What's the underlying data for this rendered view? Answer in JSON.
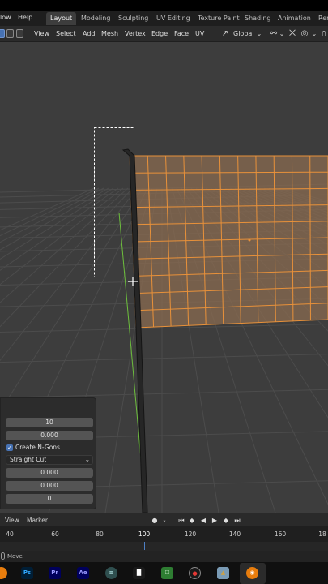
{
  "topbar": {
    "menus": [
      {
        "label": "low"
      },
      {
        "label": "Help"
      }
    ],
    "workspaces": [
      {
        "label": "Layout",
        "active": true
      },
      {
        "label": "Modeling"
      },
      {
        "label": "Sculpting"
      },
      {
        "label": "UV Editing"
      },
      {
        "label": "Texture Paint"
      },
      {
        "label": "Shading"
      },
      {
        "label": "Animation"
      },
      {
        "label": "Ren"
      }
    ]
  },
  "header": {
    "menus": [
      {
        "label": "View"
      },
      {
        "label": "Select"
      },
      {
        "label": "Add"
      },
      {
        "label": "Mesh"
      },
      {
        "label": "Vertex"
      },
      {
        "label": "Edge"
      },
      {
        "label": "Face"
      },
      {
        "label": "UV"
      }
    ],
    "transform_orientation": "Global",
    "select_modes": [
      "vertex",
      "edge",
      "face"
    ],
    "icons": [
      "transform-orientation-icon",
      "snap-icon",
      "proportional-editing-icon"
    ]
  },
  "viewport": {
    "grid_color": "#4a4a4a",
    "background": "#3d3d3d",
    "selection_color": "#e8913a",
    "y_axis_color": "#6dbf3d"
  },
  "operator_panel": {
    "number_of_cuts": "10",
    "smoothness": "0.000",
    "create_ngons_label": "Create N-Gons",
    "create_ngons_checked": true,
    "quad_corner_type": "Straight Cut",
    "fractal": "0.000",
    "along_normal": "0.000",
    "random_seed": "0"
  },
  "timeline": {
    "menus": [
      {
        "label": "View"
      },
      {
        "label": "Marker"
      }
    ],
    "frame_numbers": [
      "40",
      "60",
      "80",
      "100",
      "120",
      "140",
      "160",
      "18"
    ],
    "current_frame_marker": "100"
  },
  "statusbar": {
    "text": "Move"
  },
  "taskbar": {
    "apps": [
      {
        "label": "",
        "name": "blender-orange-icon",
        "color": "#e87d0d"
      },
      {
        "label": "Ps",
        "name": "photoshop-icon",
        "color": "#31a8ff"
      },
      {
        "label": "Pr",
        "name": "premiere-icon",
        "color": "#9999ff"
      },
      {
        "label": "Ae",
        "name": "after-effects-icon",
        "color": "#9999ff"
      },
      {
        "label": "",
        "name": "audio-app-icon",
        "color": "#a8d8d8"
      },
      {
        "label": "",
        "name": "audio-meter-icon",
        "color": "#ffffff"
      },
      {
        "label": "",
        "name": "green-app-icon",
        "color": "#4caf50"
      },
      {
        "label": "",
        "name": "recorder-icon",
        "color": "#e53935"
      },
      {
        "label": "",
        "name": "image-viewer-icon",
        "color": "#c9a14a"
      },
      {
        "label": "",
        "name": "blender-icon",
        "color": "#e87d0d"
      }
    ]
  }
}
